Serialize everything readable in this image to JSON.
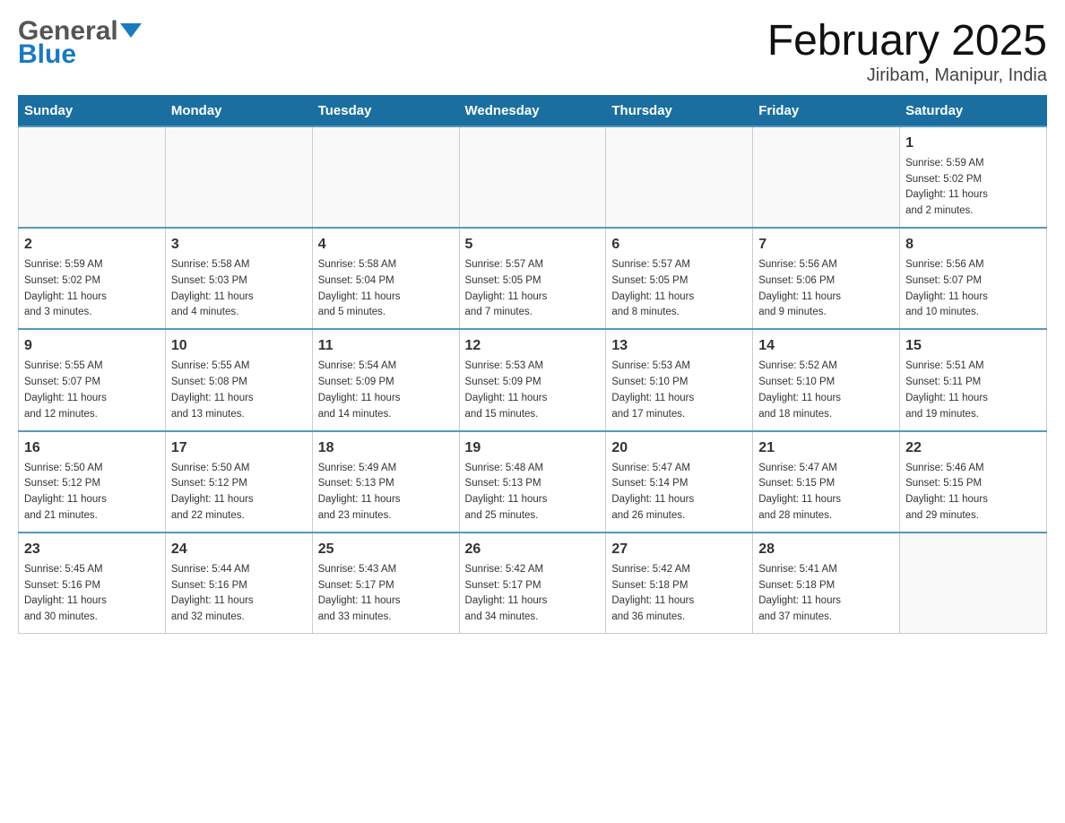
{
  "header": {
    "month_year": "February 2025",
    "location": "Jiribam, Manipur, India",
    "logo_general": "General",
    "logo_blue": "Blue"
  },
  "weekdays": [
    "Sunday",
    "Monday",
    "Tuesday",
    "Wednesday",
    "Thursday",
    "Friday",
    "Saturday"
  ],
  "weeks": [
    [
      {
        "day": "",
        "info": ""
      },
      {
        "day": "",
        "info": ""
      },
      {
        "day": "",
        "info": ""
      },
      {
        "day": "",
        "info": ""
      },
      {
        "day": "",
        "info": ""
      },
      {
        "day": "",
        "info": ""
      },
      {
        "day": "1",
        "info": "Sunrise: 5:59 AM\nSunset: 5:02 PM\nDaylight: 11 hours\nand 2 minutes."
      }
    ],
    [
      {
        "day": "2",
        "info": "Sunrise: 5:59 AM\nSunset: 5:02 PM\nDaylight: 11 hours\nand 3 minutes."
      },
      {
        "day": "3",
        "info": "Sunrise: 5:58 AM\nSunset: 5:03 PM\nDaylight: 11 hours\nand 4 minutes."
      },
      {
        "day": "4",
        "info": "Sunrise: 5:58 AM\nSunset: 5:04 PM\nDaylight: 11 hours\nand 5 minutes."
      },
      {
        "day": "5",
        "info": "Sunrise: 5:57 AM\nSunset: 5:05 PM\nDaylight: 11 hours\nand 7 minutes."
      },
      {
        "day": "6",
        "info": "Sunrise: 5:57 AM\nSunset: 5:05 PM\nDaylight: 11 hours\nand 8 minutes."
      },
      {
        "day": "7",
        "info": "Sunrise: 5:56 AM\nSunset: 5:06 PM\nDaylight: 11 hours\nand 9 minutes."
      },
      {
        "day": "8",
        "info": "Sunrise: 5:56 AM\nSunset: 5:07 PM\nDaylight: 11 hours\nand 10 minutes."
      }
    ],
    [
      {
        "day": "9",
        "info": "Sunrise: 5:55 AM\nSunset: 5:07 PM\nDaylight: 11 hours\nand 12 minutes."
      },
      {
        "day": "10",
        "info": "Sunrise: 5:55 AM\nSunset: 5:08 PM\nDaylight: 11 hours\nand 13 minutes."
      },
      {
        "day": "11",
        "info": "Sunrise: 5:54 AM\nSunset: 5:09 PM\nDaylight: 11 hours\nand 14 minutes."
      },
      {
        "day": "12",
        "info": "Sunrise: 5:53 AM\nSunset: 5:09 PM\nDaylight: 11 hours\nand 15 minutes."
      },
      {
        "day": "13",
        "info": "Sunrise: 5:53 AM\nSunset: 5:10 PM\nDaylight: 11 hours\nand 17 minutes."
      },
      {
        "day": "14",
        "info": "Sunrise: 5:52 AM\nSunset: 5:10 PM\nDaylight: 11 hours\nand 18 minutes."
      },
      {
        "day": "15",
        "info": "Sunrise: 5:51 AM\nSunset: 5:11 PM\nDaylight: 11 hours\nand 19 minutes."
      }
    ],
    [
      {
        "day": "16",
        "info": "Sunrise: 5:50 AM\nSunset: 5:12 PM\nDaylight: 11 hours\nand 21 minutes."
      },
      {
        "day": "17",
        "info": "Sunrise: 5:50 AM\nSunset: 5:12 PM\nDaylight: 11 hours\nand 22 minutes."
      },
      {
        "day": "18",
        "info": "Sunrise: 5:49 AM\nSunset: 5:13 PM\nDaylight: 11 hours\nand 23 minutes."
      },
      {
        "day": "19",
        "info": "Sunrise: 5:48 AM\nSunset: 5:13 PM\nDaylight: 11 hours\nand 25 minutes."
      },
      {
        "day": "20",
        "info": "Sunrise: 5:47 AM\nSunset: 5:14 PM\nDaylight: 11 hours\nand 26 minutes."
      },
      {
        "day": "21",
        "info": "Sunrise: 5:47 AM\nSunset: 5:15 PM\nDaylight: 11 hours\nand 28 minutes."
      },
      {
        "day": "22",
        "info": "Sunrise: 5:46 AM\nSunset: 5:15 PM\nDaylight: 11 hours\nand 29 minutes."
      }
    ],
    [
      {
        "day": "23",
        "info": "Sunrise: 5:45 AM\nSunset: 5:16 PM\nDaylight: 11 hours\nand 30 minutes."
      },
      {
        "day": "24",
        "info": "Sunrise: 5:44 AM\nSunset: 5:16 PM\nDaylight: 11 hours\nand 32 minutes."
      },
      {
        "day": "25",
        "info": "Sunrise: 5:43 AM\nSunset: 5:17 PM\nDaylight: 11 hours\nand 33 minutes."
      },
      {
        "day": "26",
        "info": "Sunrise: 5:42 AM\nSunset: 5:17 PM\nDaylight: 11 hours\nand 34 minutes."
      },
      {
        "day": "27",
        "info": "Sunrise: 5:42 AM\nSunset: 5:18 PM\nDaylight: 11 hours\nand 36 minutes."
      },
      {
        "day": "28",
        "info": "Sunrise: 5:41 AM\nSunset: 5:18 PM\nDaylight: 11 hours\nand 37 minutes."
      },
      {
        "day": "",
        "info": ""
      }
    ]
  ]
}
